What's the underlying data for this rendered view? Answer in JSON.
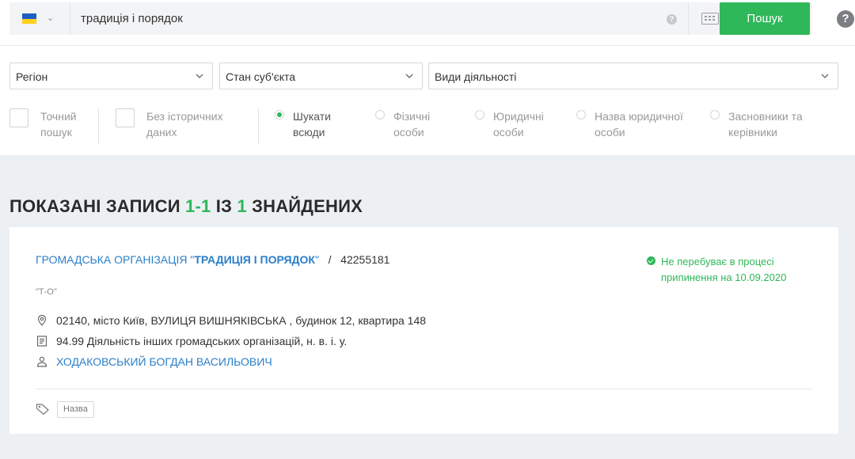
{
  "search": {
    "query": "традиція і порядок",
    "button_label": "Пошук",
    "help_symbol": "?",
    "info_symbol": "?",
    "flag_chevron": "⌄"
  },
  "filters": {
    "region": "Регіон",
    "entity_state": "Стан суб'єкта",
    "activities": "Види діяльності"
  },
  "options": {
    "exact": [
      "Точний",
      "пошук"
    ],
    "no_history": [
      "Без історичних",
      "даних"
    ],
    "search_everywhere": [
      "Шукати",
      "всюди"
    ],
    "individuals": [
      "Фізичні",
      "особи"
    ],
    "legal": [
      "Юридичні",
      "особи"
    ],
    "legal_name": [
      "Назва юридичної",
      "особи"
    ],
    "founders": [
      "Засновники та",
      "керівники"
    ],
    "selected_radio": "search_everywhere"
  },
  "results": {
    "heading_prefix": "ПОКАЗАНІ ЗАПИСИ ",
    "heading_range": "1-1",
    "heading_mid": " ІЗ ",
    "heading_count": "1",
    "heading_suffix": " ЗНАЙДЕНИХ"
  },
  "record": {
    "org_type": "ГРОМАДСЬКА ОРГАНІЗАЦІЯ \"",
    "org_name": "ТРАДИЦІЯ І ПОРЯДОК",
    "org_close": "\"",
    "separator": "/",
    "code": "42255181",
    "short_name": "\"Т-О\"",
    "status_line1": "Не перебуває в процесі",
    "status_line2": "припинення на 10.09.2020",
    "address": "02140, місто Київ, ВУЛИЦЯ ВИШНЯКІВСЬКА , будинок 12, квартира 148",
    "activity": "94.99 Діяльність інших громадських організацій, н. в. і. у.",
    "head_person": "ХОДАКОВСЬКИЙ БОГДАН ВАСИЛЬОВИЧ",
    "tag": "Назва"
  },
  "colors": {
    "accent_green": "#2fb859",
    "link_blue": "#2a7fc9",
    "page_bg": "#edf0f3"
  },
  "icons": {
    "flag": "ukraine-flag-icon",
    "keyboard": "keyboard-icon",
    "help": "help-icon",
    "address": "location-pin-icon",
    "activity": "document-list-icon",
    "person": "person-icon",
    "tag": "tag-icon",
    "status": "check-circle-icon"
  }
}
